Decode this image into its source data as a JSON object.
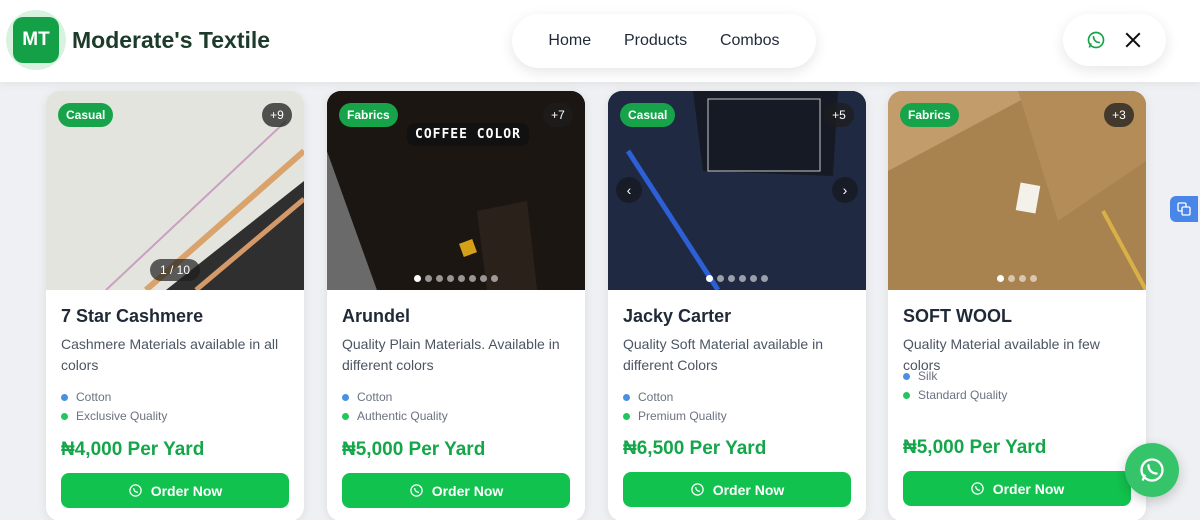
{
  "brand": {
    "logo_text": "MT",
    "name": "Moderate's Textile"
  },
  "nav": {
    "items": [
      "Home",
      "Products",
      "Combos"
    ]
  },
  "social": {
    "icons": [
      "whatsapp-icon",
      "x-icon"
    ]
  },
  "colors": {
    "accent": "#12c24e",
    "price": "#15a64a",
    "badge": "#16a34a"
  },
  "products": [
    {
      "badge": "Casual",
      "count": "+9",
      "counter": "1 / 10",
      "title": "7 Star Cashmere",
      "description": "Cashmere Materials available in all colors",
      "features": [
        {
          "text": "Cotton",
          "color": "#4a90e2"
        },
        {
          "text": "Exclusive Quality",
          "color": "#22c55e"
        }
      ],
      "price": "₦4,000 Per Yard",
      "button": "Order Now"
    },
    {
      "badge": "Fabrics",
      "count": "+7",
      "overlay_text": "COFFEE COLOR",
      "title": "Arundel",
      "description": "Quality Plain Materials. Available in different colors",
      "features": [
        {
          "text": "Cotton",
          "color": "#4a90e2"
        },
        {
          "text": "Authentic Quality",
          "color": "#22c55e"
        }
      ],
      "price": "₦5,000 Per Yard",
      "button": "Order Now"
    },
    {
      "badge": "Casual",
      "count": "+5",
      "title": "Jacky Carter",
      "description": "Quality Soft Material available in different Colors",
      "features": [
        {
          "text": "Cotton",
          "color": "#4a90e2"
        },
        {
          "text": "Premium Quality",
          "color": "#22c55e"
        }
      ],
      "price": "₦6,500 Per Yard",
      "button": "Order Now"
    },
    {
      "badge": "Fabrics",
      "count": "+3",
      "title": "SOFT WOOL",
      "description": "Quality Material available in few colors",
      "features": [
        {
          "text": "Silk",
          "color": "#4a90e2"
        },
        {
          "text": "Standard Quality",
          "color": "#22c55e"
        }
      ],
      "price": "₦5,000 Per Yard",
      "button": "Order Now"
    }
  ]
}
